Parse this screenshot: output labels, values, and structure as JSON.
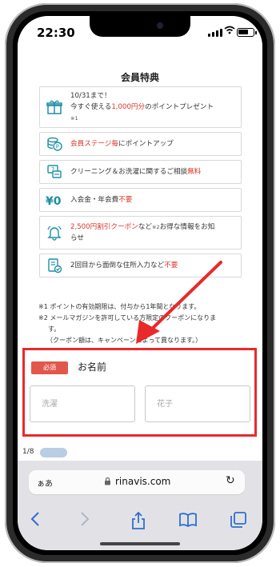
{
  "status": {
    "time": "22:30"
  },
  "page": {
    "section_title": "会員特典",
    "benefits": [
      {
        "icon": "gift-icon",
        "line1": "10/31まで！",
        "line2_pre": "今すぐ使える",
        "line2_red": "1,000円分",
        "line2_post": "のポイントプレゼント",
        "note": "※1"
      },
      {
        "icon": "coin-stack-icon",
        "red": "会員ステージ毎",
        "post": "にポイントアップ"
      },
      {
        "icon": "chat-question-icon",
        "pre": "クリーニング＆お洗濯に関するご相談",
        "red": "無料"
      },
      {
        "icon": "yen-zero-icon",
        "pre": "入会金・年会費",
        "red": "不要"
      },
      {
        "icon": "bell-icon",
        "red": "2,500円割引クーポン",
        "post": "など",
        "note": "※2",
        "post2": "お得な情報をお知",
        "line2": "らせ"
      },
      {
        "icon": "document-check-icon",
        "pre": "2回目から面倒な住所入力など",
        "red": "不要"
      }
    ],
    "notes": [
      "※1 ポイントの有効期限は、付与から1年間となります。",
      "※2 メールマガジンを許可している方限定のクーポンになりま",
      "す。",
      "（クーポン額は、キャンペーンによって異なります。）"
    ]
  },
  "form": {
    "required_badge": "必須",
    "label": "お名前",
    "last_name_placeholder": "洗濯",
    "first_name_placeholder": "花子"
  },
  "pager": {
    "text": "1/8"
  },
  "browser": {
    "aa_label": "ぁあ",
    "url": "rinavis.com"
  },
  "colors": {
    "accent_red": "#e82a2a",
    "icon_teal": "#1f8fa5",
    "ios_blue": "#2d6fd1"
  }
}
